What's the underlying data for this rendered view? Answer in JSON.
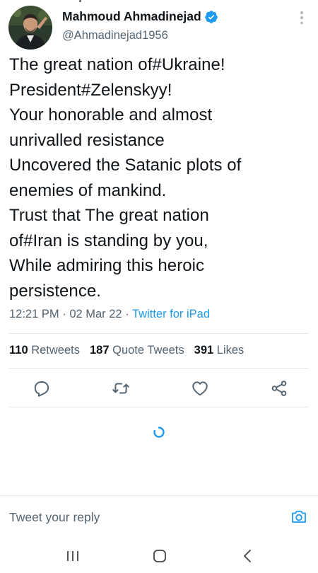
{
  "author": {
    "name": "Mahmoud Ahmadinejad",
    "handle": "@Ahmadinejad1956",
    "verified": true
  },
  "tweet": {
    "lines": [
      "The great nation of#Ukraine!",
      "President#Zelenskyy!",
      "Your honorable and almost",
      "unrivalled resistance",
      "Uncovered the Satanic plots of",
      "enemies of mankind.",
      "Trust that The great nation",
      "of#Iran is standing by you,",
      "While admiring this heroic",
      "persistence."
    ],
    "time": "12:21 PM",
    "separator": "·",
    "date": "02 Mar 22",
    "source": "Twitter for iPad"
  },
  "stats": {
    "retweets_count": "110",
    "retweets_label": "Retweets",
    "quotes_count": "187",
    "quotes_label": "Quote Tweets",
    "likes_count": "391",
    "likes_label": "Likes"
  },
  "reply": {
    "placeholder": "Tweet your reply"
  },
  "colors": {
    "accent": "#1d9bf0",
    "text": "#0f1419",
    "muted": "#536471"
  },
  "icons": [
    "verified-icon",
    "more-icon",
    "reply-icon",
    "retweet-icon",
    "like-icon",
    "share-icon",
    "camera-icon",
    "recents-icon",
    "home-icon",
    "back-icon"
  ]
}
